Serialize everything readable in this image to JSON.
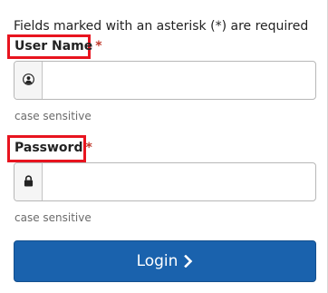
{
  "form": {
    "required_note": "Fields marked with an asterisk (*) are required",
    "username": {
      "label": "User Name",
      "asterisk": "*",
      "icon": "user-circle-icon",
      "value": "",
      "help": "case sensitive"
    },
    "password": {
      "label": "Password",
      "asterisk": "*",
      "icon": "lock-icon",
      "value": "",
      "help": "case sensitive"
    },
    "login_button": {
      "label": "Login",
      "icon": "chevron-right-icon",
      "color": "#1a62ad"
    }
  },
  "annotations": {
    "highlight_color": "#e8141f"
  }
}
